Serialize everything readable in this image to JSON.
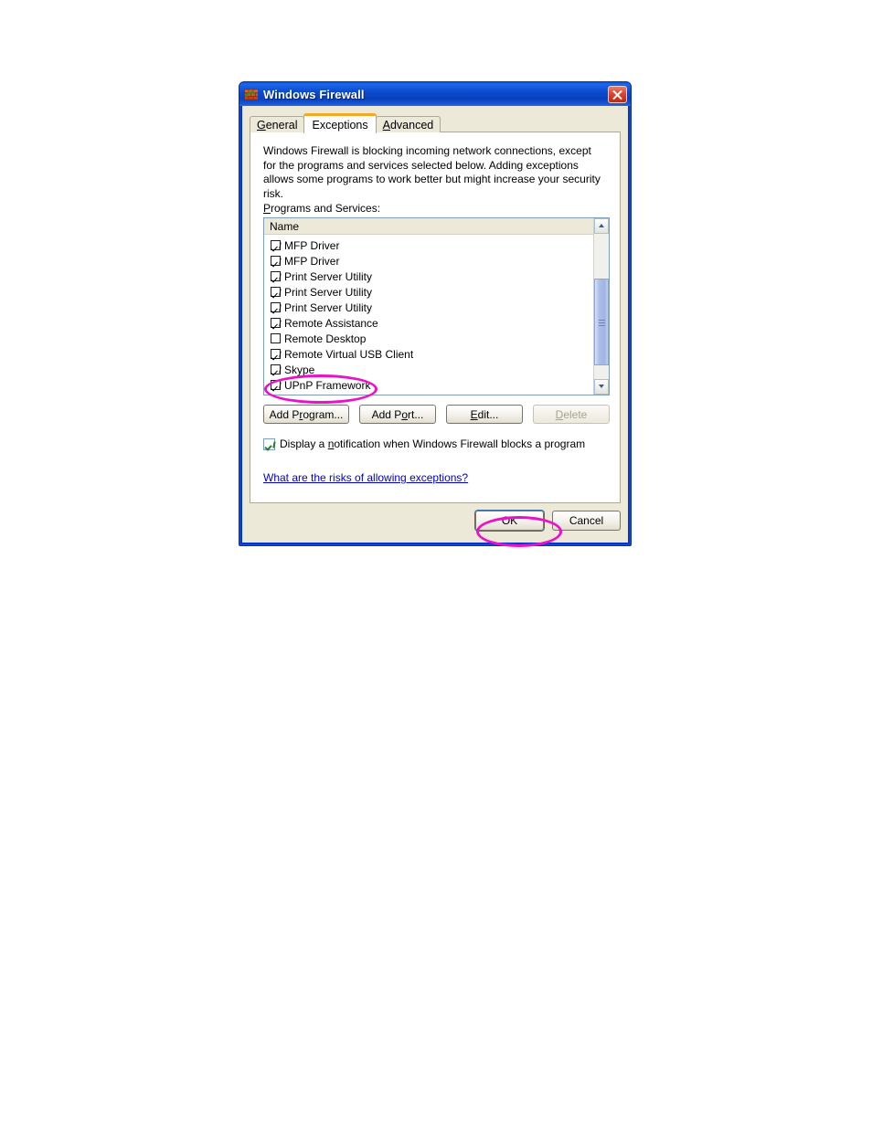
{
  "window": {
    "title": "Windows Firewall",
    "icon": "firewall-brick-icon",
    "close_label": "×",
    "frame_color": "#0a36c8"
  },
  "tabs": [
    {
      "label": "General",
      "accel": "G",
      "active": false
    },
    {
      "label": "Exceptions",
      "accel": "",
      "active": true
    },
    {
      "label": "Advanced",
      "accel": "A",
      "active": false
    }
  ],
  "page": {
    "intro": "Windows Firewall is blocking incoming network connections, except for the programs and services selected below. Adding exceptions allows some programs to work better but might increase your security risk.",
    "section_label_pre": "P",
    "section_label_rest": "rograms and Services:",
    "list_header": "Name",
    "items": [
      {
        "label": "MFP Driver",
        "checked": true
      },
      {
        "label": "MFP Driver",
        "checked": true
      },
      {
        "label": "Print Server Utility",
        "checked": true
      },
      {
        "label": "Print Server Utility",
        "checked": true
      },
      {
        "label": "Print Server Utility",
        "checked": true
      },
      {
        "label": "Remote Assistance",
        "checked": true
      },
      {
        "label": "Remote Desktop",
        "checked": false
      },
      {
        "label": "Remote Virtual USB Client",
        "checked": true
      },
      {
        "label": "Skype",
        "checked": true
      },
      {
        "label": "UPnP Framework",
        "checked": true
      }
    ],
    "buttons": [
      {
        "pre": "Add P",
        "accel": "r",
        "post": "ogram...",
        "disabled": false,
        "name": "add-program-button"
      },
      {
        "pre": "Add P",
        "accel": "o",
        "post": "rt...",
        "disabled": false,
        "name": "add-port-button"
      },
      {
        "pre": "",
        "accel": "E",
        "post": "dit...",
        "disabled": false,
        "name": "edit-button"
      },
      {
        "pre": "",
        "accel": "D",
        "post": "elete",
        "disabled": true,
        "name": "delete-button"
      }
    ],
    "notification": {
      "pre": "Display a ",
      "accel": "n",
      "post": "otification when Windows Firewall blocks a program",
      "checked": true
    },
    "risk_link": "What are the risks of allowing exceptions?"
  },
  "footer": {
    "ok_label": "OK",
    "cancel_label": "Cancel"
  },
  "annotations": {
    "accent_color": "#e912c8",
    "highlighted_item": "UPnP Framework",
    "highlighted_button": "OK"
  }
}
